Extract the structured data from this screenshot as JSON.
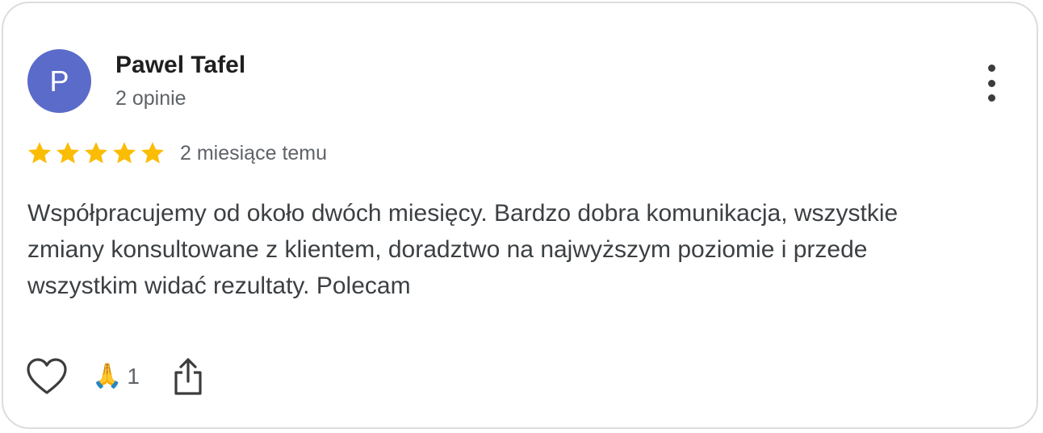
{
  "review": {
    "author": {
      "initial": "P",
      "name": "Pawel Tafel",
      "review_count": "2 opinie",
      "avatar_color": "#5b6bc9"
    },
    "rating": 5,
    "rating_max": 5,
    "star_color": "#fbbc04",
    "timestamp": "2 miesiące temu",
    "text": "Współpracujemy od około dwóch miesięcy. Bardzo dobra komunikacja, wszystkie zmiany konsultowane z klientem, doradztwo na najwyższym poziomie i przede wszystkim widać rezultaty. Polecam",
    "actions": {
      "like_icon": "heart-outline-icon",
      "reaction_emoji": "🙏",
      "reaction_count": "1",
      "share_icon": "share-icon",
      "more_icon": "more-vertical-icon"
    }
  }
}
